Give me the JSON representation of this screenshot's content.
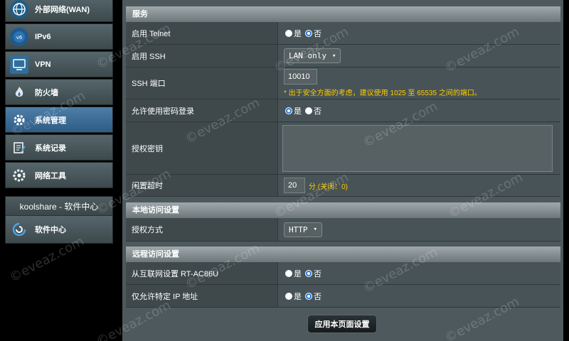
{
  "sidebar": {
    "items": [
      {
        "label": "外部网络(WAN)",
        "icon": "globe-icon",
        "active": false
      },
      {
        "label": "IPv6",
        "icon": "ipv6-icon",
        "active": false
      },
      {
        "label": "VPN",
        "icon": "vpn-icon",
        "active": false
      },
      {
        "label": "防火墙",
        "icon": "firewall-icon",
        "active": false
      },
      {
        "label": "系统管理",
        "icon": "gear-icon",
        "active": true
      },
      {
        "label": "系统记录",
        "icon": "log-icon",
        "active": false
      },
      {
        "label": "网络工具",
        "icon": "tools-icon",
        "active": false
      }
    ],
    "koolshare": {
      "title": "koolshare - 软件中心",
      "item_label": "软件中心",
      "item_icon": "software-center-icon"
    }
  },
  "sections": {
    "service": {
      "title": "服务",
      "telnet": {
        "label": "启用 Telnet",
        "yes": "是",
        "no": "否",
        "selected": "no"
      },
      "ssh": {
        "label": "启用 SSH",
        "value": "LAN only"
      },
      "ssh_port": {
        "label": "SSH 端口",
        "value": "10010",
        "hint": "* 出于安全方面的考虑，建议使用 1025 至 65535 之间的端口。"
      },
      "password_login": {
        "label": "允许使用密码登录",
        "yes": "是",
        "no": "否",
        "selected": "yes"
      },
      "auth_key": {
        "label": "授权密钥",
        "value": ""
      },
      "idle_timeout": {
        "label": "闲置超时",
        "value": "20",
        "unit": "分 (关闭：0)"
      }
    },
    "local_access": {
      "title": "本地访问设置",
      "auth_method": {
        "label": "授权方式",
        "value": "HTTP"
      }
    },
    "remote_access": {
      "title": "远程访问设置",
      "from_internet": {
        "label": "从互联网设置 RT-AC86U",
        "yes": "是",
        "no": "否",
        "selected": "no"
      },
      "specific_ip": {
        "label": "仅允许特定 IP 地址",
        "yes": "是",
        "no": "否",
        "selected": "no"
      }
    }
  },
  "apply_button": "应用本页面设置",
  "watermark": "©eveaz.com",
  "colors": {
    "accent": "#2b7ad6",
    "hint": "#ffcc00",
    "active_nav": "#3f6f99"
  }
}
